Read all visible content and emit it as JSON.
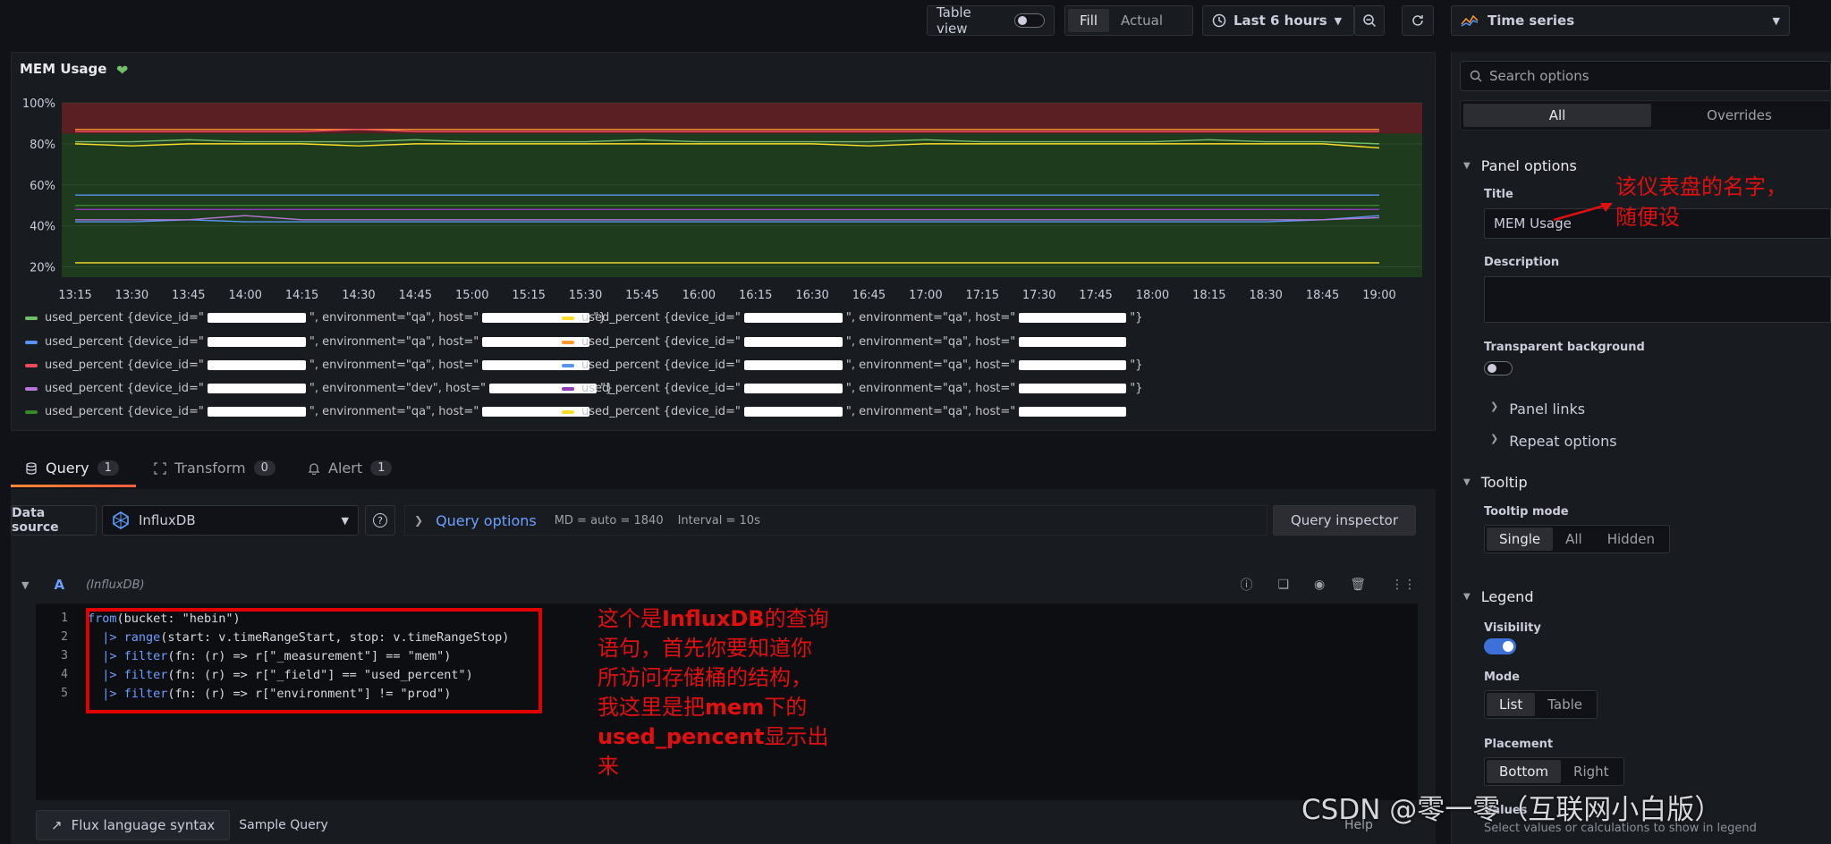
{
  "toolbar": {
    "table_view": "Table view",
    "fill": "Fill",
    "actual": "Actual",
    "time_range": "Last 6 hours"
  },
  "panel": {
    "title": "MEM Usage"
  },
  "chart_data": {
    "type": "line",
    "x": [
      "13:15",
      "13:30",
      "13:45",
      "14:00",
      "14:15",
      "14:30",
      "14:45",
      "15:00",
      "15:15",
      "15:30",
      "15:45",
      "16:00",
      "16:15",
      "16:30",
      "16:45",
      "17:00",
      "17:15",
      "17:30",
      "17:45",
      "18:00",
      "18:15",
      "18:30",
      "18:45",
      "19:00"
    ],
    "y_ticks": [
      "100%",
      "80%",
      "60%",
      "40%",
      "20%"
    ],
    "ylim": [
      15,
      100
    ],
    "thresholds": {
      "red_above": 85,
      "colors": {
        "red": "#5a1f22",
        "green": "#1f3b1e"
      }
    },
    "series": [
      {
        "color": "#73bf69",
        "values": [
          81,
          81,
          82,
          81,
          81,
          81,
          82,
          81,
          81,
          81,
          82,
          81,
          81,
          81,
          81,
          82,
          81,
          81,
          81,
          81,
          82,
          81,
          81,
          80
        ]
      },
      {
        "color": "#fade2a",
        "values": [
          80,
          79,
          80,
          80,
          80,
          79,
          80,
          80,
          80,
          80,
          80,
          80,
          80,
          80,
          79,
          80,
          80,
          80,
          80,
          80,
          80,
          80,
          80,
          78
        ]
      },
      {
        "color": "#5794f2",
        "values": [
          42,
          42,
          43,
          42,
          42,
          42,
          42,
          42,
          42,
          42,
          42,
          42,
          42,
          42,
          42,
          42,
          42,
          42,
          42,
          42,
          42,
          42,
          43,
          45
        ]
      },
      {
        "color": "#ff9830",
        "values": [
          87,
          87,
          87,
          87,
          87,
          87,
          87,
          87,
          87,
          87,
          87,
          87,
          87,
          87,
          87,
          87,
          87,
          87,
          87,
          87,
          87,
          87,
          87,
          87
        ]
      },
      {
        "color": "#f2495c",
        "values": [
          86,
          86,
          86,
          86,
          86,
          87,
          86,
          86,
          86,
          86,
          86,
          86,
          86,
          86,
          86,
          86,
          86,
          86,
          86,
          86,
          86,
          86,
          86,
          86
        ]
      },
      {
        "color": "#5794f2",
        "values": [
          55,
          55,
          55,
          55,
          55,
          55,
          55,
          55,
          55,
          55,
          55,
          55,
          55,
          55,
          55,
          55,
          55,
          55,
          55,
          55,
          55,
          55,
          55,
          55
        ]
      },
      {
        "color": "#b877d9",
        "values": [
          43,
          43,
          43,
          45,
          43,
          43,
          43,
          43,
          43,
          43,
          43,
          43,
          43,
          43,
          43,
          43,
          43,
          43,
          43,
          43,
          43,
          43,
          43,
          44
        ]
      },
      {
        "color": "#8f3bb8",
        "values": [
          48,
          48,
          48,
          48,
          48,
          48,
          48,
          48,
          48,
          48,
          48,
          48,
          48,
          48,
          48,
          48,
          48,
          48,
          48,
          48,
          48,
          48,
          48,
          48
        ]
      },
      {
        "color": "#37872d",
        "values": [
          50,
          50,
          50,
          50,
          50,
          50,
          50,
          50,
          50,
          50,
          50,
          50,
          50,
          50,
          50,
          50,
          50,
          50,
          50,
          50,
          50,
          50,
          50,
          50
        ]
      },
      {
        "color": "#fade2a",
        "values": [
          22,
          22,
          22,
          22,
          22,
          22,
          22,
          22,
          22,
          22,
          22,
          22,
          22,
          22,
          22,
          22,
          22,
          22,
          22,
          22,
          22,
          22,
          22,
          22
        ]
      }
    ]
  },
  "legend": [
    {
      "text_a": "used_percent {device_id=\"",
      "text_b": "\", environment=\"qa\", host=\"",
      "text_c": "\"}"
    },
    {
      "text_a": "used_percent {device_id=\"",
      "text_b": "\", environment=\"qa\", host=\"",
      "text_c": "\"}"
    },
    {
      "text_a": "used_percent {device_id=\"",
      "text_b": "\", environment=\"qa\", host=\"",
      "text_c": ""
    },
    {
      "text_a": "used_percent {device_id=\"",
      "text_b": "\", environment=\"qa\", host=\"",
      "text_c": ""
    },
    {
      "text_a": "used_percent {device_id=\"",
      "text_b": "\", environment=\"qa\", host=\"",
      "text_c": ""
    },
    {
      "text_a": "used_percent {device_id=\"",
      "text_b": "\", environment=\"qa\", host=\"",
      "text_c": "\"}"
    },
    {
      "text_a": "used_percent {device_id=\"",
      "text_b": "\", environment=\"dev\", host=\"",
      "text_c": "\"}"
    },
    {
      "text_a": "used_percent {device_id=\"",
      "text_b": "\", environment=\"qa\", host=\"",
      "text_c": "\"}"
    },
    {
      "text_a": "used_percent {device_id=\"",
      "text_b": "\", environment=\"qa\", host=\"",
      "text_c": ""
    },
    {
      "text_a": "used_percent {device_id=\"",
      "text_b": "\", environment=\"qa\", host=\"",
      "text_c": ""
    }
  ],
  "tabs": [
    {
      "label": "Query",
      "count": "1"
    },
    {
      "label": "Transform",
      "count": "0"
    },
    {
      "label": "Alert",
      "count": "1"
    }
  ],
  "query": {
    "ds_label": "Data source",
    "ds_value": "InfluxDB",
    "options_label": "Query options",
    "md": "MD = auto = 1840",
    "interval": "Interval = 10s",
    "inspector": "Query inspector",
    "ref": "A",
    "ref_ds": "(InfluxDB)",
    "lines": [
      {
        "n": "1",
        "kw": "from",
        "rest": "(bucket: \"hebin\")"
      },
      {
        "n": "2",
        "kw": "  |> range",
        "rest": "(start: v.timeRangeStart, stop: v.timeRangeStop)"
      },
      {
        "n": "3",
        "kw": "  |> filter",
        "rest": "(fn: (r) => r[\"_measurement\"] == \"mem\")"
      },
      {
        "n": "4",
        "kw": "  |> filter",
        "rest": "(fn: (r) => r[\"_field\"] == \"used_percent\")"
      },
      {
        "n": "5",
        "kw": "  |> filter",
        "rest": "(fn: (r) => r[\"environment\"] != \"prod\")"
      }
    ],
    "flux_syntax": "Flux language syntax",
    "sample_query": "Sample Query",
    "help": "Help"
  },
  "annotation_code": {
    "l1a": "这个是",
    "l1b": "InfluxDB",
    "l1c": "的查询",
    "l2": "语句，首先你要知道你",
    "l3": "所访问存储桶的结构，",
    "l4a": "我这里是把",
    "l4b": "mem",
    "l4c": "下的",
    "l5a": "used_pencent",
    "l5b": "显示出",
    "l6": "来"
  },
  "annotation_title": {
    "l1": "该仪表盘的名字，",
    "l2": "随便设"
  },
  "options": {
    "viz": "Time series",
    "search_placeholder": "Search options",
    "all": "All",
    "overrides": "Overrides",
    "panel_options": "Panel options",
    "title_label": "Title",
    "title_value": "MEM Usage",
    "description_label": "Description",
    "transparent_label": "Transparent background",
    "panel_links": "Panel links",
    "repeat_options": "Repeat options",
    "tooltip": "Tooltip",
    "tooltip_mode": "Tooltip mode",
    "tm_single": "Single",
    "tm_all": "All",
    "tm_hidden": "Hidden",
    "legend": "Legend",
    "visibility": "Visibility",
    "mode": "Mode",
    "mode_list": "List",
    "mode_table": "Table",
    "placement": "Placement",
    "pl_bottom": "Bottom",
    "pl_right": "Right",
    "values": "Values",
    "values_desc": "Select values or calculations to show in legend"
  },
  "watermark": "CSDN @零一零（互联网小白版）"
}
